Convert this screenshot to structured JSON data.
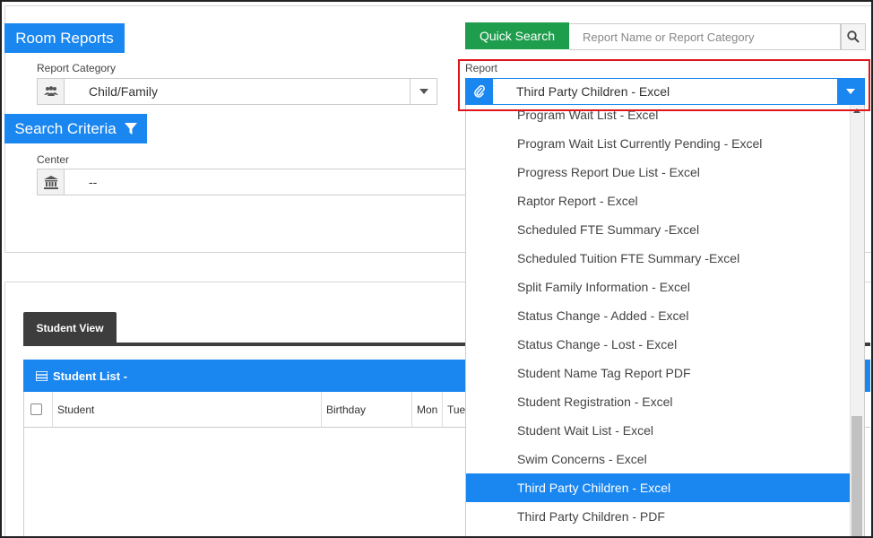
{
  "header": {
    "room_reports_label": "Room Reports",
    "search_criteria_label": "Search Criteria"
  },
  "report_category": {
    "label": "Report Category",
    "value": "Child/Family"
  },
  "center": {
    "label": "Center",
    "value": "--"
  },
  "quick_search": {
    "button_label": "Quick Search",
    "placeholder": "Report Name or Report Category"
  },
  "report": {
    "label": "Report",
    "value": "Third Party Children - Excel"
  },
  "dropdown": {
    "items": [
      "Program Wait List - Excel",
      "Program Wait List Currently Pending - Excel",
      "Progress Report Due List - Excel",
      "Raptor Report - Excel",
      "Scheduled FTE Summary -Excel",
      "Scheduled Tuition FTE Summary -Excel",
      "Split Family Information - Excel",
      "Status Change - Added - Excel",
      "Status Change - Lost - Excel",
      "Student Name Tag Report PDF",
      "Student Registration - Excel",
      "Student Wait List - Excel",
      "Swim Concerns - Excel",
      "Third Party Children - Excel",
      "Third Party Children - PDF"
    ],
    "selected": "Third Party Children - Excel"
  },
  "student_view": {
    "tab_label": "Student View",
    "list_title": "Student List -",
    "columns": [
      "Student",
      "Birthday",
      "Mon",
      "Tue"
    ]
  },
  "colors": {
    "primary_blue": "#1a86f0",
    "quick_search_green": "#1e9d4d",
    "highlight_red": "#e0141b",
    "tab_dark": "#3d3d3d"
  }
}
